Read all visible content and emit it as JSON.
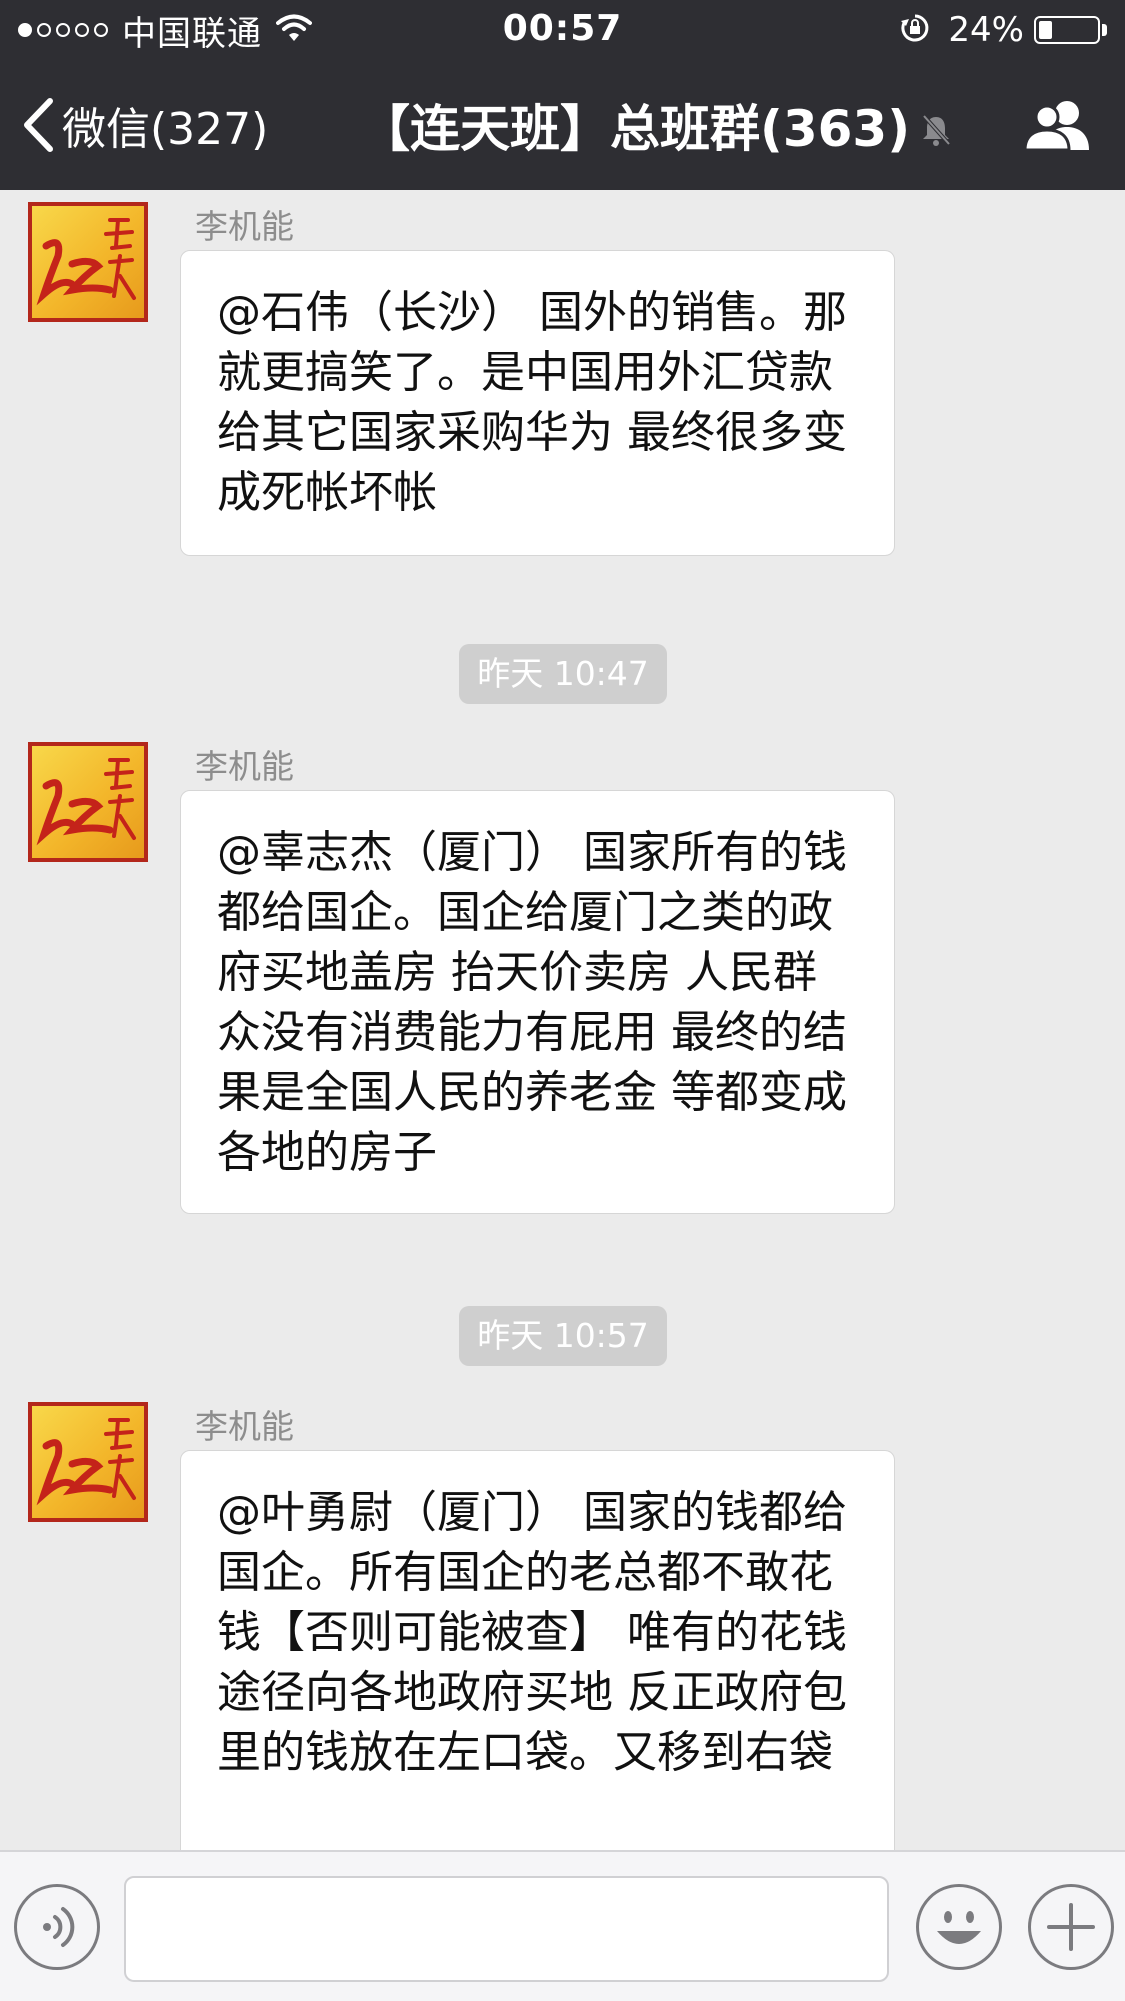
{
  "status_bar": {
    "carrier": "中国联通",
    "time": "00:57",
    "battery_percent_text": "24%",
    "battery_level": 0.24,
    "signal_bars_filled": 1,
    "signal_bars_total": 5
  },
  "nav": {
    "back_label": "微信(327)",
    "title": "【连天班】总班群(363)",
    "muted": true
  },
  "messages": [
    {
      "sender": "李机能",
      "text": "@石伟（长沙） 国外的销售。那就更搞笑了。是中国用外汇贷款给其它国家采购华为  最终很多变成死帐坏帐"
    },
    {
      "timestamp": "昨天 10:47",
      "sender": "李机能",
      "text": "@辜志杰（厦门） 国家所有的钱都给国企。国企给厦门之类的政府买地盖房 抬天价卖房 人民群众没有消费能力有屁用  最终的结果是全国人民的养老金 等都变成各地的房子"
    },
    {
      "timestamp": "昨天 10:57",
      "sender": "李机能",
      "text": "@叶勇尉（厦门） 国家的钱都给国企。所有国企的老总都不敢花钱【否则可能被查】 唯有的花钱途径向各地政府买地 反正政府包里的钱放在左口袋。又移到右袋"
    }
  ],
  "input_bar": {
    "voice_icon": "voice-icon",
    "emoji_icon": "emoji-icon",
    "plus_icon": "plus-icon"
  },
  "colors": {
    "bar_background": "#2e2e33",
    "chat_background": "#ebebeb",
    "avatar_red": "#c4231a"
  }
}
